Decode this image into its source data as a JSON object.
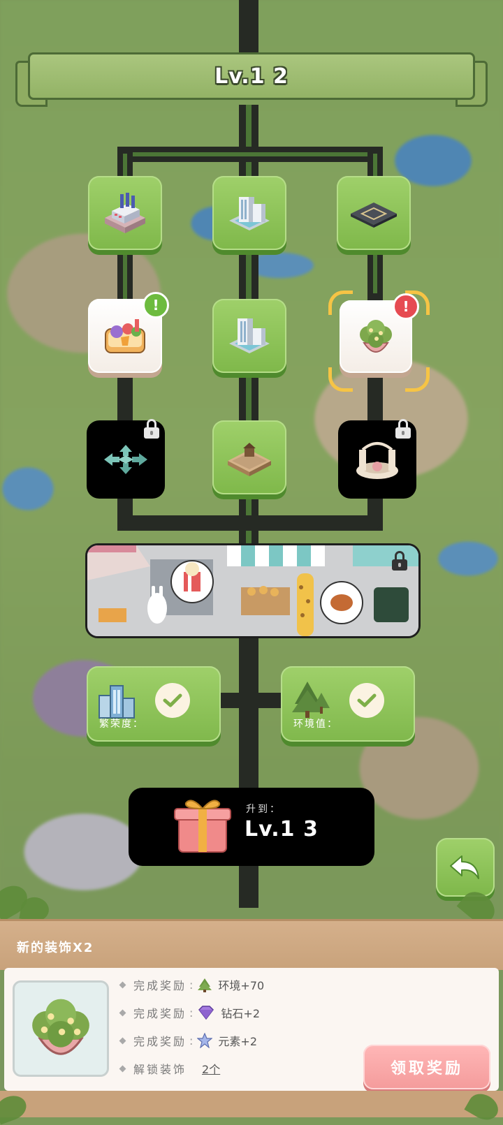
{
  "header": {
    "level_title": "Lv.1 2"
  },
  "tree": {
    "nodes": [
      {
        "id": "factory",
        "state": "unlocked",
        "icon": "factory-icon"
      },
      {
        "id": "skyscraper-1",
        "state": "unlocked",
        "icon": "skyscraper-icon"
      },
      {
        "id": "plaza",
        "state": "unlocked",
        "icon": "plaza-icon"
      },
      {
        "id": "lunchbox",
        "state": "new",
        "icon": "lunchbox-icon",
        "badge": "!"
      },
      {
        "id": "skyscraper-2",
        "state": "unlocked",
        "icon": "skyscraper-icon"
      },
      {
        "id": "flower-pot",
        "state": "selected",
        "icon": "flower-pot-icon",
        "badge": "!"
      },
      {
        "id": "expand",
        "state": "locked",
        "icon": "expand-arrows-icon"
      },
      {
        "id": "cabin",
        "state": "unlocked",
        "icon": "cabin-icon"
      },
      {
        "id": "fountain",
        "state": "locked",
        "icon": "fountain-icon"
      }
    ],
    "market_locked": true
  },
  "requirements": {
    "prosperity_label": "繁荣度：",
    "environment_label": "环境值："
  },
  "levelup": {
    "caption": "升到：",
    "next_level": "Lv.1 3"
  },
  "panel": {
    "title": "新的装饰X2",
    "rows": [
      {
        "key": "完成奖励",
        "icon": "tree-icon",
        "value": "环境+70"
      },
      {
        "key": "完成奖励",
        "icon": "diamond-icon",
        "value": "钻石+2"
      },
      {
        "key": "完成奖励",
        "icon": "element-icon",
        "value": "元素+2"
      },
      {
        "key": "解锁装饰",
        "value": "2个"
      }
    ],
    "claim_label": "领取奖励"
  },
  "colors": {
    "green": "#8cc35a",
    "dark_track": "#262a24",
    "alert_red": "#e64b52",
    "claim_pink": "#f7a8a8"
  }
}
